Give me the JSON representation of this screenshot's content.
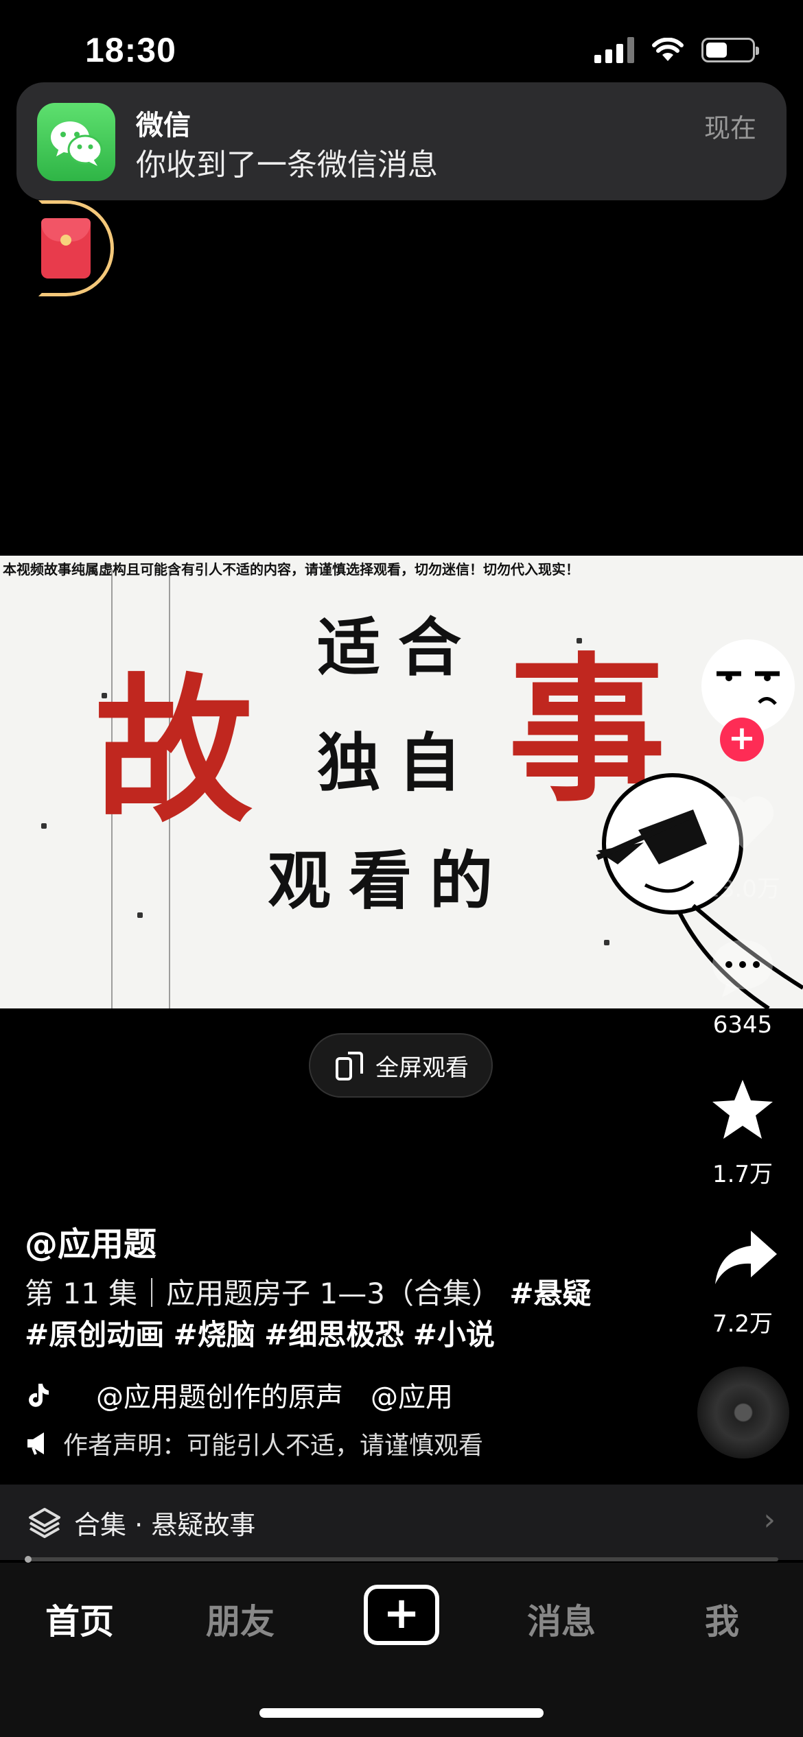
{
  "status_bar": {
    "time": "18:30"
  },
  "notification": {
    "app": "微信",
    "message": "你收到了一条微信消息",
    "time": "现在"
  },
  "video": {
    "disclaimer": "本视频故事纯属虚构且可能含有引人不适的内容，请谨慎选择观看，切勿迷信！切勿代入现实！",
    "red_left": "故",
    "red_right": "事",
    "line1": "适合",
    "line2": "独自",
    "line3": "观看的"
  },
  "fullscreen_button": {
    "label": "全屏观看"
  },
  "side_actions": {
    "likes": "13.0万",
    "comments": "6345",
    "favorites": "1.7万",
    "shares": "7.2万"
  },
  "post": {
    "author": "@应用题",
    "description": "第 11 集｜应用题房子 1—3（合集）",
    "hashtags": [
      "#悬疑",
      "#原创动画",
      "#烧脑",
      "#细思极恐",
      "#小说"
    ],
    "music": "@应用题创作的原声　@应用",
    "notice": "作者声明：可能引人不适，请谨慎观看"
  },
  "collection": {
    "label": "合集 · 悬疑故事"
  },
  "nav": {
    "home": "首页",
    "friends": "朋友",
    "add": "+",
    "messages": "消息",
    "me": "我"
  },
  "colors": {
    "accent": "#fe2c55",
    "wechat": "#4cd964",
    "title_red": "#c0271f"
  }
}
